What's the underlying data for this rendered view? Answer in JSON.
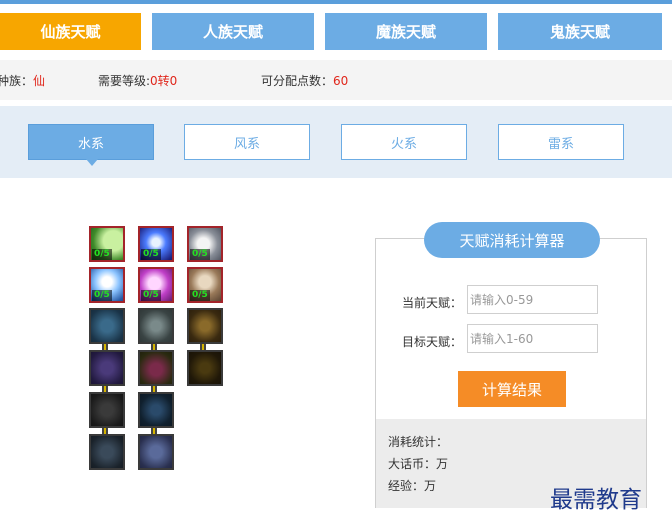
{
  "race_tabs": [
    {
      "label": "仙族天赋"
    },
    {
      "label": "人族天赋"
    },
    {
      "label": "魔族天赋"
    },
    {
      "label": "鬼族天赋"
    }
  ],
  "info": {
    "race_label": "种族：",
    "race_value": "仙",
    "level_label": "需要等级:",
    "level_value": "0转0",
    "points_label": "可分配点数：",
    "points_value": "60"
  },
  "element_tabs": [
    {
      "label": "水系"
    },
    {
      "label": "风系"
    },
    {
      "label": "火系"
    },
    {
      "label": "雷系"
    }
  ],
  "talents": [
    {
      "level": "0/5"
    },
    {
      "level": "0/5"
    },
    {
      "level": "0/5"
    },
    {
      "level": "0/5"
    },
    {
      "level": "0/5"
    },
    {
      "level": "0/5"
    }
  ],
  "calculator": {
    "title": "天赋消耗计算器",
    "current_label": "当前天赋：",
    "current_placeholder": "请输入0-59",
    "target_label": "目标天赋：",
    "target_placeholder": "请输入1-60",
    "button_label": "计算结果",
    "stats_title": "消耗统计：",
    "money_line": "大话币：万",
    "exp_line": "经验：万"
  },
  "watermark": "最需教育",
  "colors": {
    "active_tab": "#f7a600",
    "tab_blue": "#6cace4",
    "button_orange": "#f58c26",
    "value_red": "#e0261b"
  }
}
